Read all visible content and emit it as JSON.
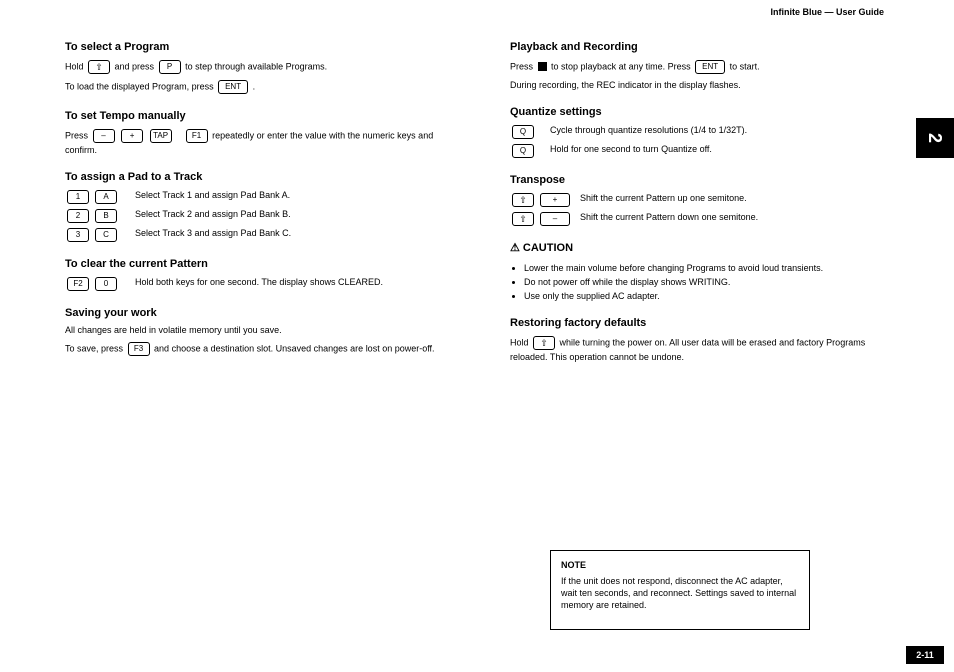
{
  "header": {
    "running": "Infinite Blue — User Guide"
  },
  "page": {
    "tab": "2",
    "number": "2-11"
  },
  "left": {
    "s1": {
      "title": "To select a Program",
      "p1a": "Hold ",
      "p1b": " and press ",
      "p1c": " to step through available Programs.",
      "key1": "⇧",
      "key2": "P",
      "p2a": "To load the displayed Program, press ",
      "key3": "ENT",
      "p2b": "."
    },
    "s2": {
      "title": "To set Tempo manually",
      "p1a": "Press ",
      "p1b": " repeatedly or enter the value with the numeric keys and confirm.",
      "keys": [
        "–",
        "+",
        "TAP"
      ],
      "key_extra": "F1"
    },
    "s3": {
      "title": "To assign a Pad to a Track",
      "rows": [
        {
          "k": [
            "1",
            "A"
          ],
          "d": "Select Track 1 and assign Pad Bank A."
        },
        {
          "k": [
            "2",
            "B"
          ],
          "d": "Select Track 2 and assign Pad Bank B."
        },
        {
          "k": [
            "3",
            "C"
          ],
          "d": "Select Track 3 and assign Pad Bank C."
        }
      ]
    },
    "s4": {
      "title": "To clear the current Pattern",
      "row": {
        "k": [
          "F2",
          "0"
        ],
        "d": "Hold both keys for one second. The display shows CLEARED."
      }
    },
    "s5": {
      "title": "Saving your work",
      "p1": "All changes are held in volatile memory until you save.",
      "p2a": "To save, press ",
      "key": "F3",
      "p2b": " and choose a destination slot. Unsaved changes are lost on power-off."
    }
  },
  "right": {
    "s1": {
      "title": "Playback and Recording",
      "p1a": "Press ",
      "p1b": " to stop playback at any time. Press ",
      "key_ent": "ENT",
      "p1c": " to start.",
      "p2": "During recording, the REC indicator in the display flashes."
    },
    "s2": {
      "title": "Quantize settings",
      "rows": [
        {
          "k": [
            "Q"
          ],
          "d": "Cycle through quantize resolutions (1/4 to 1/32T)."
        },
        {
          "k": [
            "Q"
          ],
          "d": "Hold for one second to turn Quantize off."
        }
      ]
    },
    "s3": {
      "title": "Transpose",
      "rows": [
        {
          "shift": true,
          "k": [
            "+"
          ],
          "d": "Shift the current Pattern up one semitone."
        },
        {
          "shift": true,
          "k": [
            "–"
          ],
          "d": "Shift the current Pattern down one semitone."
        }
      ]
    },
    "warn": {
      "title": "⚠ CAUTION",
      "items": [
        "Lower the main volume before changing Programs to avoid loud transients.",
        "Do not power off while the display shows WRITING.",
        "Use only the supplied AC adapter."
      ]
    },
    "s4": {
      "title": "Restoring factory defaults",
      "p1a": "Hold ",
      "p1b": " while turning the power on. All user data will be erased and factory Programs reloaded. This operation cannot be undone.",
      "shift": true
    }
  },
  "callout": {
    "title": "NOTE",
    "body": "If the unit does not respond, disconnect the AC adapter, wait ten seconds, and reconnect. Settings saved to internal memory are retained."
  }
}
